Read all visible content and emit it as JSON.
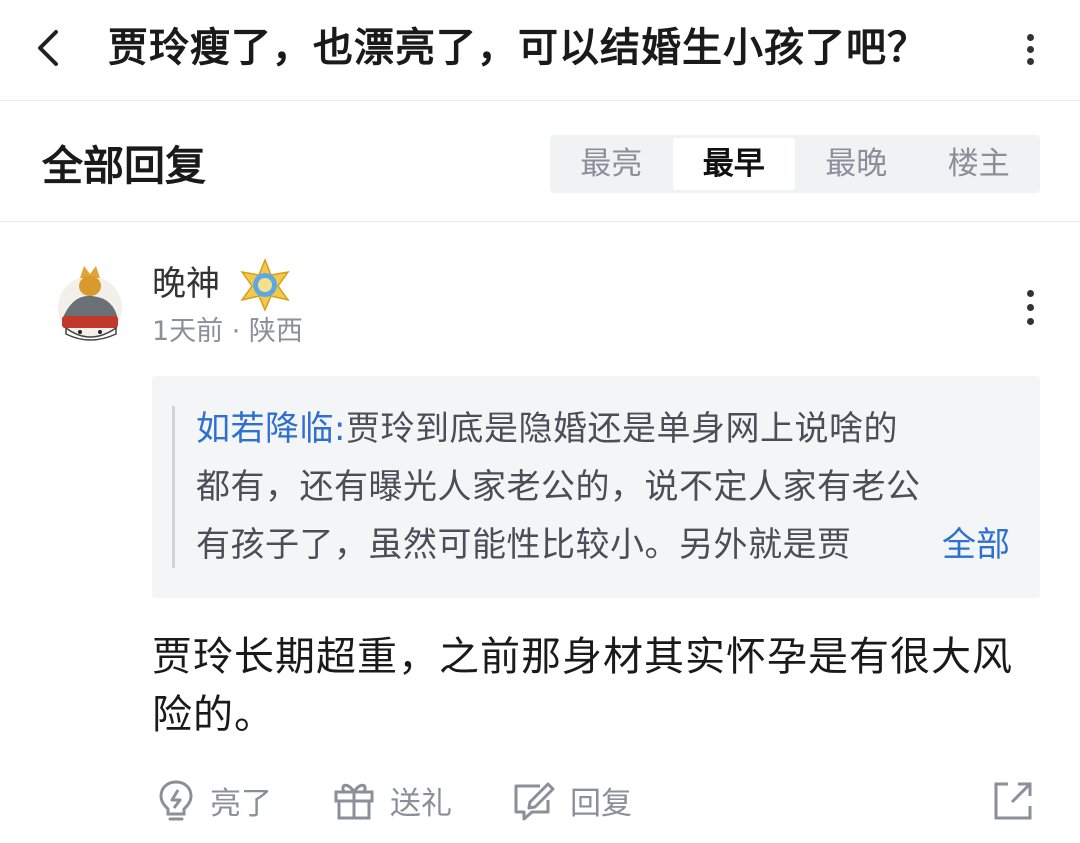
{
  "header": {
    "title": "贾玲瘦了，也漂亮了，可以结婚生小孩了吧？",
    "back_icon": "chevron-left-icon",
    "more_icon": "more-vertical-icon"
  },
  "replies_header": {
    "title": "全部回复",
    "sort_tabs": [
      {
        "label": "最亮",
        "active": false
      },
      {
        "label": "最早",
        "active": true
      },
      {
        "label": "最晚",
        "active": false
      },
      {
        "label": "楼主",
        "active": false
      }
    ]
  },
  "post": {
    "username": "晚神",
    "time_location": "1天前 · 陕西",
    "quote": {
      "author": "如若降临:",
      "lines": [
        "贾玲到底是隐婚还是单身网上说啥的",
        "都有，还有曝光人家老公的，说不定人家有老公",
        "有孩子了，虽然可能性比较小。另外就是贾"
      ],
      "expand_label": "全部"
    },
    "content": "贾玲长期超重，之前那身材其实怀孕是有很大风险的。",
    "actions": {
      "like": "亮了",
      "gift": "送礼",
      "reply": "回复"
    }
  },
  "colors": {
    "accent_blue": "#2e6fd0",
    "muted_text": "#8a8f99",
    "quote_bg": "#f4f5f7"
  }
}
